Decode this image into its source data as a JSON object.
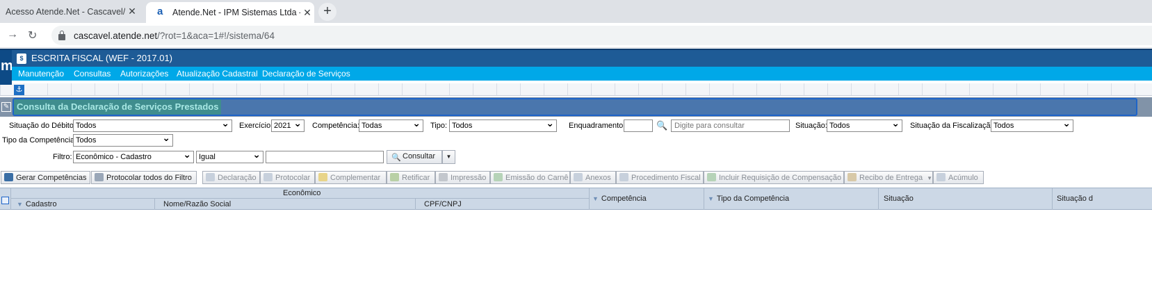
{
  "browser": {
    "tabs": [
      {
        "title": "Acesso Atende.Net - Cascavel/PR",
        "active": false
      },
      {
        "title": "Atende.Net - IPM Sistemas Ltda - ",
        "active": true
      }
    ],
    "new_tab_label": "+",
    "url_host": "cascavel.atende.net",
    "url_rest": "/?rot=1&aca=1#!/sistema/64"
  },
  "app": {
    "logo_letter": "m",
    "module_icon": "$",
    "title": "ESCRITA FISCAL (WEF - 2017.01)",
    "menu": [
      "Manutenção",
      "Consultas",
      "Autorizações",
      "Atualização Cadastral",
      "Declaração de Serviços"
    ],
    "anchor_icon": "⚓"
  },
  "panel": {
    "title": "Consulta da Declaração de Serviços Prestados"
  },
  "filters": {
    "situacao_debito": {
      "label": "Situação do Débito:",
      "value": "Todos"
    },
    "exercicio": {
      "label": "Exercício:",
      "value": "2021"
    },
    "competencia": {
      "label": "Competência:",
      "value": "Todas"
    },
    "tipo": {
      "label": "Tipo:",
      "value": "Todos"
    },
    "enquadramento": {
      "label": "Enquadramento:",
      "value": "",
      "placeholder": "Digite para consultar"
    },
    "situacao": {
      "label": "Situação:",
      "value": "Todos"
    },
    "situacao_fiscalizacao": {
      "label": "Situação da Fiscalização:",
      "value": "Todos"
    },
    "tipo_competencia": {
      "label": "Tipo da Competência:",
      "value": "Todos"
    },
    "filtro": {
      "label": "Filtro:",
      "field": "Econômico - Cadastro",
      "operator": "Igual",
      "value": ""
    },
    "consultar_label": "Consultar"
  },
  "toolbar": {
    "gerar": "Gerar Competências",
    "protocolar_todos": "Protocolar todos do Filtro",
    "declaracao": "Declaração",
    "protocolar": "Protocolar",
    "complementar": "Complementar",
    "retificar": "Retificar",
    "impressao": "Impressão",
    "emissao_carne": "Emissão do Carnê",
    "anexos": "Anexos",
    "procedimento_fiscal": "Procedimento Fiscal",
    "incluir_requisicao": "Incluir Requisição de Compensação",
    "recibo_entrega": "Recibo de Entrega",
    "acumulo": "Acúmulo"
  },
  "table": {
    "group_header": "Econômico",
    "columns": [
      "Cadastro",
      "Nome/Razão Social",
      "CPF/CNPJ",
      "Competência",
      "Tipo da Competência",
      "Situação",
      "Situação d"
    ]
  },
  "colors": {
    "header": "#1e5b96",
    "menu": "#00a8e8",
    "panel_title": "#4a76ad"
  }
}
